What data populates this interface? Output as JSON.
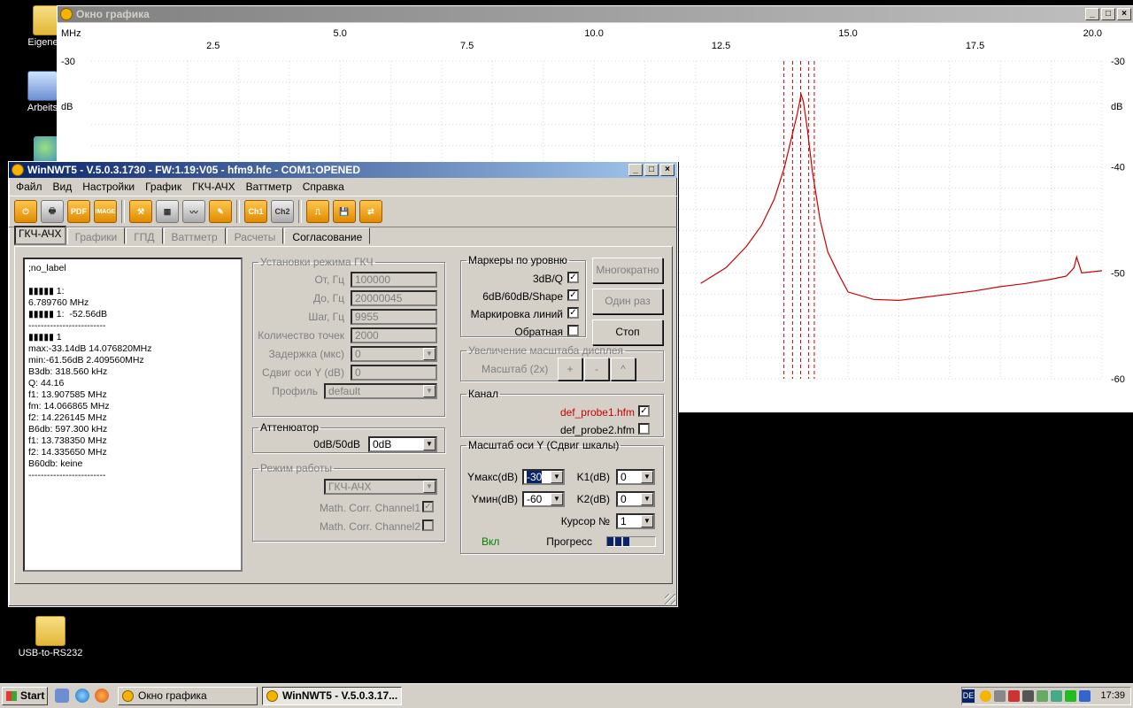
{
  "desktop": {
    "icons": [
      {
        "label": "Eigene D"
      },
      {
        "label": "Arbeits"
      },
      {
        "label": "USB-to-RS232"
      }
    ]
  },
  "graph_window": {
    "title": "Окно графика",
    "buttons": [
      "_",
      "□",
      "×"
    ],
    "x_unit": "MHz",
    "y_unit": "dB",
    "x_ticks_major": [
      "5.0",
      "10.0",
      "15.0",
      "20.0"
    ],
    "x_ticks_minor": [
      "2.5",
      "7.5",
      "12.5",
      "17.5"
    ],
    "y_ticks": [
      "-30",
      "-40",
      "-50",
      "-60"
    ]
  },
  "chart_data": {
    "type": "line",
    "title": "",
    "xlabel": "MHz",
    "ylabel": "dB",
    "xlim": [
      0.1,
      20.0
    ],
    "ylim": [
      -60,
      -30
    ],
    "grid": true,
    "series": [
      {
        "color": "#cc0000",
        "x": [
          12.1,
          12.6,
          13.0,
          13.3,
          13.55,
          13.75,
          13.9,
          14.0,
          14.05,
          14.076,
          14.12,
          14.2,
          14.3,
          14.45,
          14.6,
          14.8,
          15.0,
          15.5,
          16.0,
          16.5,
          17.0,
          17.5,
          18.0,
          18.5,
          19.0,
          19.3,
          19.45,
          19.5,
          19.6,
          20.0
        ],
        "y": [
          -51.0,
          -49.5,
          -47.5,
          -45.5,
          -43.0,
          -40.0,
          -37.0,
          -35.0,
          -33.8,
          -33.14,
          -33.8,
          -36.5,
          -40.5,
          -45.0,
          -48.0,
          -50.0,
          -51.8,
          -52.5,
          -52.6,
          -52.3,
          -52.0,
          -51.7,
          -51.3,
          -51.0,
          -50.6,
          -50.3,
          -49.5,
          -48.5,
          -50.0,
          -49.8
        ]
      }
    ],
    "markers_mhz": [
      13.738,
      13.908,
      14.067,
      14.226,
      14.336
    ]
  },
  "main_window": {
    "title": "WinNWT5 - V.5.0.3.1730 - FW:1.19:V05 - hfm9.hfc - COM1:OPENED",
    "menu": [
      "Файл",
      "Вид",
      "Настройки",
      "График",
      "ГКЧ-АЧХ",
      "Ваттметр",
      "Справка"
    ],
    "toolbar": [
      {
        "icon": "power-icon"
      },
      {
        "icon": "print-icon"
      },
      {
        "icon": "pdf-icon",
        "label": "PDF"
      },
      {
        "icon": "image-icon",
        "label": "IMAGE"
      },
      {
        "icon": "tools-icon"
      },
      {
        "icon": "grid-icon"
      },
      {
        "icon": "chart-icon"
      },
      {
        "icon": "probe-icon"
      },
      {
        "icon": "ch1-icon",
        "label": "Ch1"
      },
      {
        "icon": "ch2-icon",
        "label": "Ch2"
      },
      {
        "icon": "sweep-icon"
      },
      {
        "icon": "save-icon"
      },
      {
        "icon": "swap-icon"
      }
    ],
    "tabs": [
      "ГКЧ-АЧХ",
      "Графики",
      "ГПД",
      "Ваттметр",
      "Расчеты",
      "Согласование"
    ],
    "info_text": ";no_label\n\n▮▮▮▮▮ 1:\n6.789760 MHz\n▮▮▮▮▮ 1:  -52.56dB\n-------------------------\n▮▮▮▮▮ 1\nmax:-33.14dB 14.076820MHz\nmin:-61.56dB 2.409560MHz\nB3db: 318.560 kHz\nQ: 44.16\nf1: 13.907585 MHz\nfm: 14.066865 MHz\nf2: 14.226145 MHz\nB6db: 597.300 kHz\nf1: 13.738350 MHz\nf2: 14.335650 MHz\nB60db: keine\n-------------------------",
    "sweep": {
      "legend": "Установки режима ГКЧ",
      "from_label": "От, Гц",
      "from_value": "100000",
      "to_label": "До, Гц",
      "to_value": "20000045",
      "step_label": "Шаг, Гц",
      "step_value": "9955",
      "points_label": "Количество точек",
      "points_value": "2000",
      "delay_label": "Задержка (мкс)",
      "delay_value": "0",
      "yshift_label": "Сдвиг оси Y (dB)",
      "yshift_value": "0",
      "profile_label": "Профиль",
      "profile_value": "default"
    },
    "attenuator": {
      "legend": "Аттенюатор",
      "label": "0dB/50dB",
      "value": "0dB"
    },
    "mode": {
      "legend": "Режим работы",
      "value": "ГКЧ-АЧХ",
      "corr1_label": "Math. Corr. Channel1",
      "corr1": true,
      "corr2_label": "Math. Corr. Channel2",
      "corr2": false
    },
    "markers": {
      "legend": "Маркеры по уровню",
      "items": [
        {
          "label": "3dB/Q",
          "checked": true
        },
        {
          "label": "6dB/60dB/Shape",
          "checked": true
        },
        {
          "label": "Маркировка линий",
          "checked": true
        },
        {
          "label": "Обратная",
          "checked": false
        }
      ]
    },
    "buttons": {
      "multi": "Многократно",
      "once": "Один раз",
      "stop": "Стоп"
    },
    "zoom": {
      "legend": "Увеличение масштаба дисплея",
      "label": "Масштаб (2x)",
      "plus": "+",
      "minus": "-",
      "up": "^"
    },
    "channel": {
      "legend": "Канал",
      "probe1": "def_probe1.hfm",
      "probe1_checked": true,
      "probe2": "def_probe2.hfm",
      "probe2_checked": false
    },
    "yscale": {
      "legend": "Масштаб оси Y (Сдвиг шкалы)",
      "ymax_label": "Yмакс(dB)",
      "ymax": "-30",
      "ymin_label": "Yмин(dB)",
      "ymin": "-60",
      "k1_label": "K1(dB)",
      "k1": "0",
      "k2_label": "K2(dB)",
      "k2": "0",
      "cursor_label": "Курсор №",
      "cursor": "1",
      "on_label": "Вкл",
      "progress_label": "Прогресс",
      "progress": 0.5,
      "accent": "#0a246a"
    }
  },
  "taskbar": {
    "start": "Start",
    "tasks": [
      {
        "label": "Окно графика",
        "active": false
      },
      {
        "label": "WinNWT5 - V.5.0.3.17...",
        "active": true
      }
    ],
    "lang": "DE",
    "clock": "17:39"
  }
}
